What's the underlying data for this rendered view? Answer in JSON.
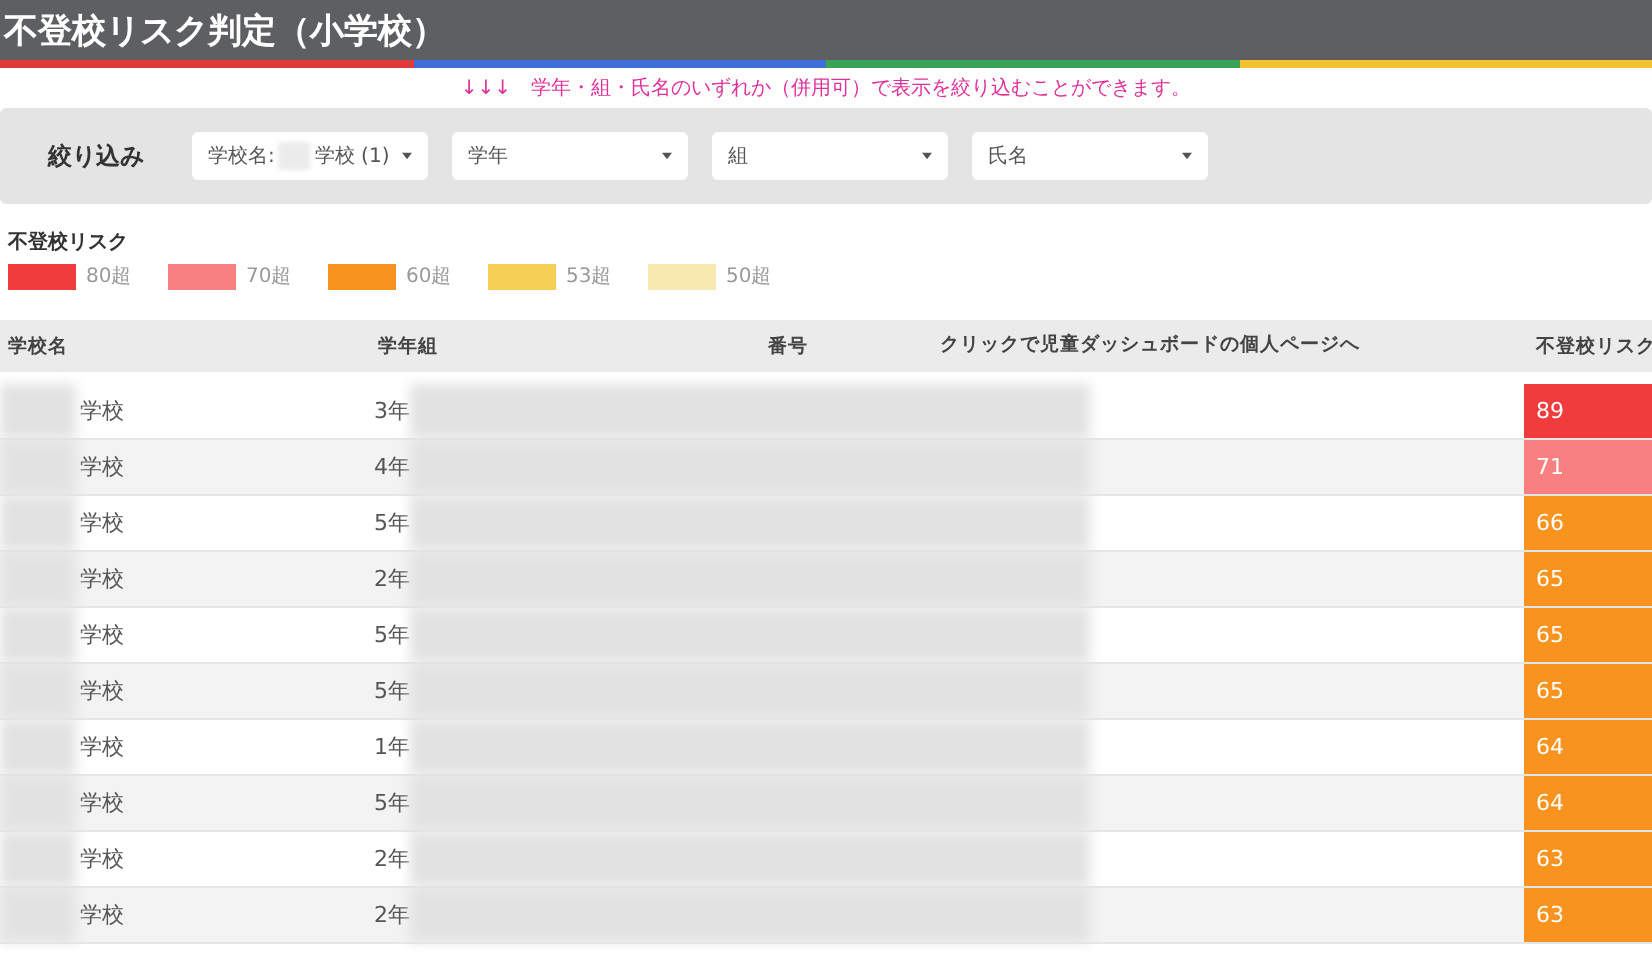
{
  "title": "不登校リスク判定（小学校）",
  "note": "↓↓↓　学年・組・氏名のいずれか（併用可）で表示を絞り込むことができます。",
  "filters": {
    "label": "絞り込み",
    "dropdowns": [
      {
        "label": "学校名:",
        "value": "学校 (1)"
      },
      {
        "value": "学年"
      },
      {
        "value": "組"
      },
      {
        "value": "氏名"
      }
    ]
  },
  "legend": {
    "title": "不登校リスク",
    "items": [
      {
        "label": "80超",
        "color": "#f03c3c"
      },
      {
        "label": "70超",
        "color": "#f88080"
      },
      {
        "label": "60超",
        "color": "#f7931e"
      },
      {
        "label": "53超",
        "color": "#f5d054"
      },
      {
        "label": "50超",
        "color": "#f8e9b0"
      }
    ]
  },
  "table": {
    "columns": [
      "学校名",
      "学年組",
      "番号",
      "クリックで児童ダッシュボードの個人ページへ",
      "不登校リスク"
    ],
    "rows": [
      {
        "school": "学校",
        "grade": "3年",
        "risk": "89",
        "color": "#f03c3c"
      },
      {
        "school": "学校",
        "grade": "4年",
        "risk": "71",
        "color": "#f88080"
      },
      {
        "school": "学校",
        "grade": "5年",
        "risk": "66",
        "color": "#f7931e"
      },
      {
        "school": "学校",
        "grade": "2年",
        "risk": "65",
        "color": "#f7931e"
      },
      {
        "school": "学校",
        "grade": "5年",
        "risk": "65",
        "color": "#f7931e"
      },
      {
        "school": "学校",
        "grade": "5年",
        "risk": "65",
        "color": "#f7931e"
      },
      {
        "school": "学校",
        "grade": "1年",
        "risk": "64",
        "color": "#f7931e"
      },
      {
        "school": "学校",
        "grade": "5年",
        "risk": "64",
        "color": "#f7931e"
      },
      {
        "school": "学校",
        "grade": "2年",
        "risk": "63",
        "color": "#f7931e"
      },
      {
        "school": "学校",
        "grade": "2年",
        "risk": "63",
        "color": "#f7931e"
      }
    ]
  }
}
